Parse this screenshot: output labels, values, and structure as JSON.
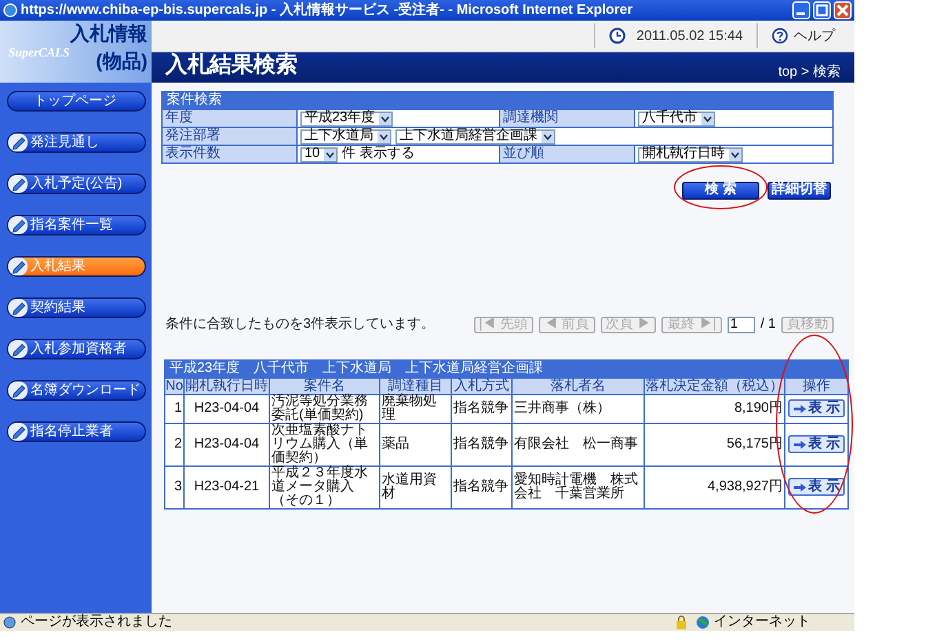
{
  "window": {
    "title": "https://www.chiba-ep-bis.supercals.jp - 入札情報サービス -受注者- - Microsoft Internet Explorer"
  },
  "header": {
    "brand": "SuperCALS",
    "logo_title": "入札情報",
    "logo_subtitle": "(物品)",
    "datetime": "2011.05.02 15:44",
    "help": "ヘルプ",
    "page_title": "入札結果検索",
    "breadcrumb": "top > 検索"
  },
  "sidebar": {
    "items": [
      {
        "label": "トップページ",
        "kind": "plain",
        "selected": false
      },
      {
        "label": "発注見通し",
        "kind": "icon",
        "selected": false
      },
      {
        "label": "入札予定(公告)",
        "kind": "icon",
        "selected": false
      },
      {
        "label": "指名案件一覧",
        "kind": "icon",
        "selected": false
      },
      {
        "label": "入札結果",
        "kind": "icon",
        "selected": true
      },
      {
        "label": "契約結果",
        "kind": "icon",
        "selected": false
      },
      {
        "label": "入札参加資格者",
        "kind": "icon",
        "selected": false
      },
      {
        "label": "名簿ダウンロード",
        "kind": "icon",
        "selected": false
      },
      {
        "label": "指名停止業者",
        "kind": "icon",
        "selected": false
      }
    ]
  },
  "search_form": {
    "title": "案件検索",
    "rows": [
      [
        {
          "label": "年度",
          "controls": [
            {
              "kind": "select",
              "value": "平成23年度"
            }
          ]
        },
        {
          "label": "調達機関",
          "controls": [
            {
              "kind": "select",
              "value": "八千代市"
            }
          ]
        }
      ],
      [
        {
          "label": "発注部署",
          "controls": [
            {
              "kind": "select",
              "value": "上下水道局"
            },
            {
              "kind": "select",
              "value": "上下水道局経営企画課"
            }
          ]
        }
      ],
      [
        {
          "label": "表示件数",
          "controls": [
            {
              "kind": "select",
              "value": "10"
            },
            {
              "kind": "text",
              "value": "件 表示する"
            }
          ]
        },
        {
          "label": "並び順",
          "controls": [
            {
              "kind": "select",
              "value": "開札執行日時"
            }
          ]
        }
      ]
    ],
    "buttons": [
      {
        "label": "検 索",
        "circled": true
      },
      {
        "label": "詳細切替",
        "circled": false
      }
    ]
  },
  "results": {
    "message": "条件に合致したものを3件表示しています。",
    "pager": [
      {
        "label": "|◀ 先頭",
        "disabled": true
      },
      {
        "label": "◀ 前頁",
        "disabled": true
      },
      {
        "label": "次頁 ▶",
        "disabled": true
      },
      {
        "label": "最終 ▶|",
        "disabled": true
      }
    ],
    "page_input": "1",
    "page_total": "/ 1",
    "go_button": {
      "label": "頁移動",
      "disabled": true
    },
    "caption": "平成23年度　八千代市　上下水道局　上下水道局経営企画課",
    "action_column_circled": true,
    "columns": [
      "No",
      "開札執行日時",
      "案件名",
      "調達種目",
      "入札方式",
      "落札者名",
      "落札決定金額（税込）",
      "操作"
    ],
    "rows": [
      {
        "no": "1",
        "date": "H23-04-04",
        "name": "汚泥等処分業務委託(単価契約)",
        "category": "廃棄物処理",
        "method": "指名競争",
        "winner": "三井商事（株）",
        "amount": "8,190円",
        "action": "表 示"
      },
      {
        "no": "2",
        "date": "H23-04-04",
        "name": "次亜塩素酸ナトリウム購入（単価契約）",
        "category": "薬品",
        "method": "指名競争",
        "winner": "有限会社　松一商事",
        "amount": "56,175円",
        "action": "表 示"
      },
      {
        "no": "3",
        "date": "H23-04-21",
        "name": "平成２３年度水道メータ購入（その１）",
        "category": "水道用資材",
        "method": "指名競争",
        "winner": "愛知時計電機　株式会社　千葉営業所",
        "amount": "4,938,927円",
        "action": "表 示"
      }
    ]
  },
  "status_bar": {
    "message": "ページが表示されました",
    "zone": "インターネット"
  }
}
